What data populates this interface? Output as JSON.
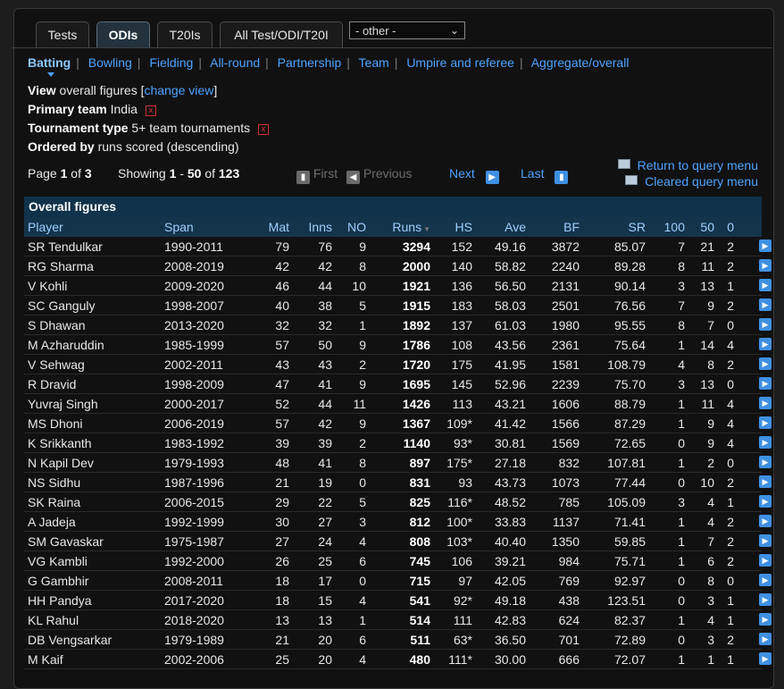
{
  "tabs": [
    {
      "label": "Tests",
      "active": false
    },
    {
      "label": "ODIs",
      "active": true
    },
    {
      "label": "T20Is",
      "active": false
    },
    {
      "label": "All Test/ODI/T20I",
      "active": false
    }
  ],
  "other_select": {
    "value": "- other -"
  },
  "nav": {
    "items": [
      "Batting",
      "Bowling",
      "Fielding",
      "All-round",
      "Partnership",
      "Team",
      "Umpire and referee",
      "Aggregate/overall"
    ],
    "active": "Batting"
  },
  "meta": {
    "view_label": "View",
    "view_text": "overall figures [",
    "view_link": "change view",
    "view_close": "]",
    "primary_team_label": "Primary team",
    "primary_team_value": "India",
    "tournament_label": "Tournament type",
    "tournament_value": "5+ team tournaments",
    "ordered_label": "Ordered by",
    "ordered_value": "runs scored (descending)"
  },
  "pagination": {
    "page_prefix": "Page",
    "page": "1",
    "of": "of",
    "pages": "3",
    "showing": "Showing",
    "from": "1",
    "dash": "-",
    "to": "50",
    "of2": "of",
    "total": "123",
    "first": "First",
    "previous": "Previous",
    "next": "Next",
    "last": "Last"
  },
  "query": {
    "return": "Return to query menu",
    "cleared": "Cleared query menu"
  },
  "table": {
    "caption": "Overall figures",
    "columns": [
      "Player",
      "Span",
      "Mat",
      "Inns",
      "NO",
      "Runs",
      "HS",
      "Ave",
      "BF",
      "SR",
      "100",
      "50",
      "0"
    ],
    "rows": [
      [
        "SR Tendulkar",
        "1990-2011",
        "79",
        "76",
        "9",
        "3294",
        "152",
        "49.16",
        "3872",
        "85.07",
        "7",
        "21",
        "2"
      ],
      [
        "RG Sharma",
        "2008-2019",
        "42",
        "42",
        "8",
        "2000",
        "140",
        "58.82",
        "2240",
        "89.28",
        "8",
        "11",
        "2"
      ],
      [
        "V Kohli",
        "2009-2020",
        "46",
        "44",
        "10",
        "1921",
        "136",
        "56.50",
        "2131",
        "90.14",
        "3",
        "13",
        "1"
      ],
      [
        "SC Ganguly",
        "1998-2007",
        "40",
        "38",
        "5",
        "1915",
        "183",
        "58.03",
        "2501",
        "76.56",
        "7",
        "9",
        "2"
      ],
      [
        "S Dhawan",
        "2013-2020",
        "32",
        "32",
        "1",
        "1892",
        "137",
        "61.03",
        "1980",
        "95.55",
        "8",
        "7",
        "0"
      ],
      [
        "M Azharuddin",
        "1985-1999",
        "57",
        "50",
        "9",
        "1786",
        "108",
        "43.56",
        "2361",
        "75.64",
        "1",
        "14",
        "4"
      ],
      [
        "V Sehwag",
        "2002-2011",
        "43",
        "43",
        "2",
        "1720",
        "175",
        "41.95",
        "1581",
        "108.79",
        "4",
        "8",
        "2"
      ],
      [
        "R Dravid",
        "1998-2009",
        "47",
        "41",
        "9",
        "1695",
        "145",
        "52.96",
        "2239",
        "75.70",
        "3",
        "13",
        "0"
      ],
      [
        "Yuvraj Singh",
        "2000-2017",
        "52",
        "44",
        "11",
        "1426",
        "113",
        "43.21",
        "1606",
        "88.79",
        "1",
        "11",
        "4"
      ],
      [
        "MS Dhoni",
        "2006-2019",
        "57",
        "42",
        "9",
        "1367",
        "109*",
        "41.42",
        "1566",
        "87.29",
        "1",
        "9",
        "4"
      ],
      [
        "K Srikkanth",
        "1983-1992",
        "39",
        "39",
        "2",
        "1140",
        "93*",
        "30.81",
        "1569",
        "72.65",
        "0",
        "9",
        "4"
      ],
      [
        "N Kapil Dev",
        "1979-1993",
        "48",
        "41",
        "8",
        "897",
        "175*",
        "27.18",
        "832",
        "107.81",
        "1",
        "2",
        "0"
      ],
      [
        "NS Sidhu",
        "1987-1996",
        "21",
        "19",
        "0",
        "831",
        "93",
        "43.73",
        "1073",
        "77.44",
        "0",
        "10",
        "2"
      ],
      [
        "SK Raina",
        "2006-2015",
        "29",
        "22",
        "5",
        "825",
        "116*",
        "48.52",
        "785",
        "105.09",
        "3",
        "4",
        "1"
      ],
      [
        "A Jadeja",
        "1992-1999",
        "30",
        "27",
        "3",
        "812",
        "100*",
        "33.83",
        "1137",
        "71.41",
        "1",
        "4",
        "2"
      ],
      [
        "SM Gavaskar",
        "1975-1987",
        "27",
        "24",
        "4",
        "808",
        "103*",
        "40.40",
        "1350",
        "59.85",
        "1",
        "7",
        "2"
      ],
      [
        "VG Kambli",
        "1992-2000",
        "26",
        "25",
        "6",
        "745",
        "106",
        "39.21",
        "984",
        "75.71",
        "1",
        "6",
        "2"
      ],
      [
        "G Gambhir",
        "2008-2011",
        "18",
        "17",
        "0",
        "715",
        "97",
        "42.05",
        "769",
        "92.97",
        "0",
        "8",
        "0"
      ],
      [
        "HH Pandya",
        "2017-2020",
        "18",
        "15",
        "4",
        "541",
        "92*",
        "49.18",
        "438",
        "123.51",
        "0",
        "3",
        "1"
      ],
      [
        "KL Rahul",
        "2018-2020",
        "13",
        "13",
        "1",
        "514",
        "111",
        "42.83",
        "624",
        "82.37",
        "1",
        "4",
        "1"
      ],
      [
        "DB Vengsarkar",
        "1979-1989",
        "21",
        "20",
        "6",
        "511",
        "63*",
        "36.50",
        "701",
        "72.89",
        "0",
        "3",
        "2"
      ],
      [
        "M Kaif",
        "2002-2006",
        "25",
        "20",
        "4",
        "480",
        "111*",
        "30.00",
        "666",
        "72.07",
        "1",
        "1",
        "1"
      ]
    ]
  },
  "colors": {
    "link": "#4da3ff",
    "header_bg": "#14344b",
    "caption_bg": "#10324a",
    "row_button": "#3f90e2"
  }
}
